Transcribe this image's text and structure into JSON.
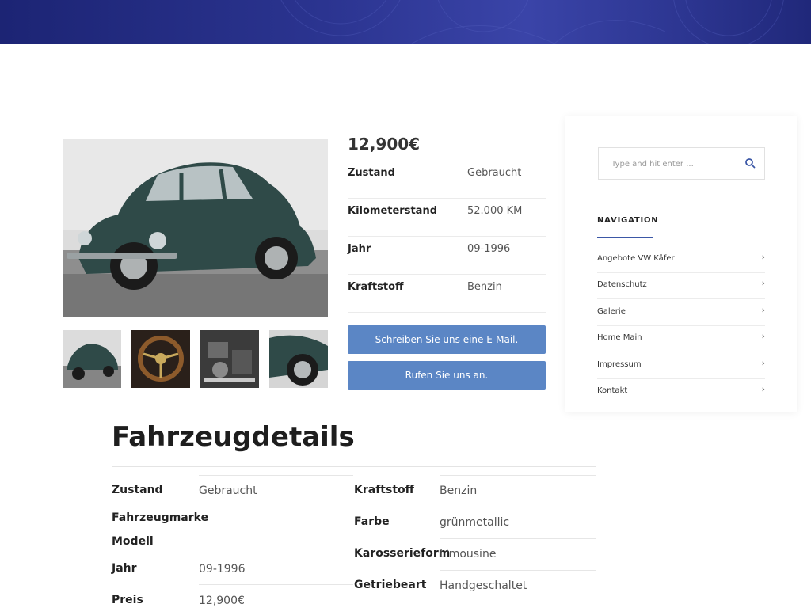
{
  "price": "12,900€",
  "specs": [
    {
      "label": "Zustand",
      "value": "Gebraucht"
    },
    {
      "label": "Kilometerstand",
      "value": "52.000 KM"
    },
    {
      "label": "Jahr",
      "value": "09-1996"
    },
    {
      "label": "Kraftstoff",
      "value": "Benzin"
    }
  ],
  "buttons": {
    "email": "Schreiben Sie uns eine E-Mail.",
    "call": "Rufen Sie uns an."
  },
  "sidebar": {
    "search_placeholder": "Type and hit enter ...",
    "nav_title": "NAVIGATION",
    "items": [
      {
        "label": "Angebote VW Käfer"
      },
      {
        "label": "Datenschutz"
      },
      {
        "label": "Galerie"
      },
      {
        "label": "Home Main"
      },
      {
        "label": "Impressum"
      },
      {
        "label": "Kontakt"
      }
    ],
    "chevron": "›"
  },
  "details": {
    "title": "Fahrzeugdetails",
    "left": [
      {
        "label": "Zustand",
        "value": "Gebraucht"
      },
      {
        "label": "Fahrzeugmarke",
        "value": ""
      },
      {
        "label": "Modell",
        "value": ""
      },
      {
        "label": "Jahr",
        "value": "09-1996"
      },
      {
        "label": "Preis",
        "value": "12,900€"
      }
    ],
    "right": [
      {
        "label": "Kraftstoff",
        "value": "Benzin"
      },
      {
        "label": "Farbe",
        "value": "grünmetallic"
      },
      {
        "label": "Karosserieform",
        "value": "Limousine"
      },
      {
        "label": "Getriebeart",
        "value": "Handgeschaltet"
      }
    ]
  },
  "colors": {
    "accent": "#5b86c5",
    "nav_accent": "#3b57a6",
    "hero": "#2b3490"
  },
  "icons": [
    "search-icon",
    "chevron-right-icon"
  ]
}
